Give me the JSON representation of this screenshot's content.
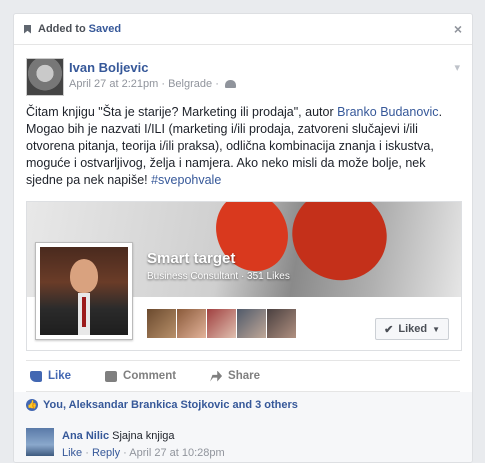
{
  "saved_bar": {
    "prefix": "Added to",
    "saved_label": "Saved",
    "close_icon": "close-icon"
  },
  "post": {
    "author": "Ivan Boljevic",
    "timestamp": "April 27 at 2:21pm",
    "location": "Belgrade",
    "separator": "·",
    "text_part1": "Čitam knjigu \"Šta je starije? Marketing ili prodaja\", autor ",
    "text_link": "Branko Budanovic",
    "text_part2": ". Mogao bih je nazvati I/ILI (marketing i/ili prodaja, zatvoreni slučajevi i/ili otvorena pitanja, teorija i/ili praksa), odlična kombinacija znanja i iskustva, moguće i ostvarljivog, želja i namjera. Ako neko misli da može bolje, nek sjedne pa nek napiše! ",
    "hashtag": "#svepohvale"
  },
  "shared_page": {
    "title": "Smart target",
    "subtitle": "Business Consultant · 351 Likes",
    "liked_button": "Liked"
  },
  "actions": {
    "like": "Like",
    "comment": "Comment",
    "share": "Share"
  },
  "likes_summary": "You, Aleksandar Brankica Stojkovic and 3 others",
  "comment": {
    "author": "Ana Nilic",
    "text": "Sjajna knjiga",
    "like": "Like",
    "reply": "Reply",
    "timestamp": "April 27 at 10:28pm"
  },
  "colors": {
    "link": "#365899",
    "accent": "#4267b2",
    "glove": "#d9391e"
  }
}
